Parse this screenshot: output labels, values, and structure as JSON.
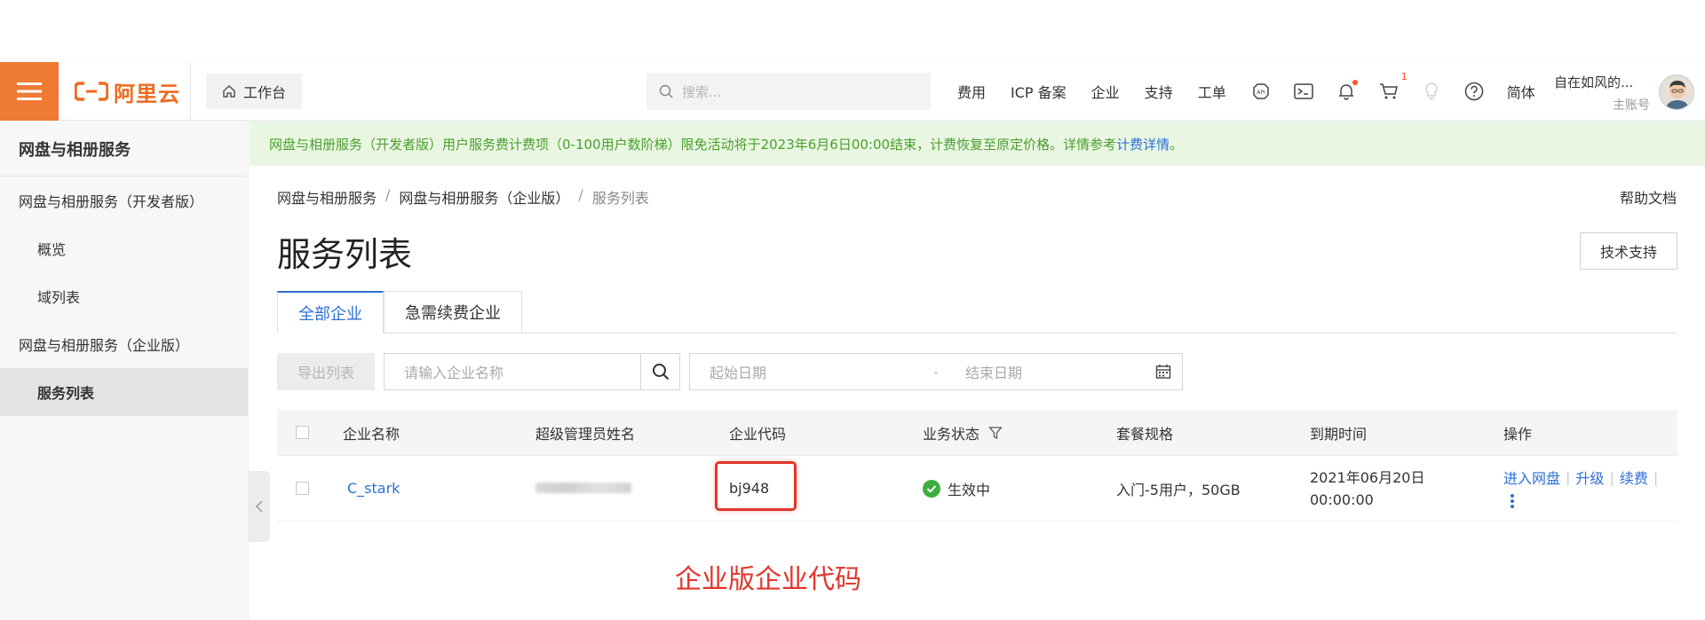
{
  "header": {
    "logo_text": "阿里云",
    "workbench_label": "工作台",
    "search_placeholder": "搜索...",
    "nav": [
      "费用",
      "ICP 备案",
      "企业",
      "支持",
      "工单"
    ],
    "cart_count": "1",
    "language": "简体",
    "user_name": "自在如风的...",
    "user_role": "主账号",
    "accent_color": "#ef7a33"
  },
  "sidebar": {
    "title": "网盘与相册服务",
    "items": [
      {
        "label": "网盘与相册服务（开发者版）"
      },
      {
        "label": "概览"
      },
      {
        "label": "域列表"
      },
      {
        "label": "网盘与相册服务（企业版）"
      },
      {
        "label": "服务列表"
      }
    ]
  },
  "notice": {
    "text": "网盘与相册服务（开发者版）用户服务费计费项（0-100用户数阶梯）限免活动将于2023年6月6日00:00结束，计费恢复至原定价格。详情参考",
    "link": "计费详情",
    "suffix": "。"
  },
  "breadcrumb": {
    "items": [
      "网盘与相册服务",
      "网盘与相册服务（企业版）",
      "服务列表"
    ],
    "separator": "/"
  },
  "help_link": "帮助文档",
  "page_title": "服务列表",
  "tech_support_label": "技术支持",
  "tabs": [
    {
      "label": "全部企业"
    },
    {
      "label": "急需续费企业"
    }
  ],
  "toolbar": {
    "export_label": "导出列表",
    "enterprise_placeholder": "请输入企业名称",
    "start_date_placeholder": "起始日期",
    "date_separator": "-",
    "end_date_placeholder": "结束日期"
  },
  "table": {
    "headers": [
      "企业名称",
      "超级管理员姓名",
      "企业代码",
      "业务状态",
      "套餐规格",
      "到期时间",
      "操作"
    ],
    "rows": [
      {
        "name": "C_stark",
        "code": "bj948",
        "status": "生效中",
        "plan": "入门-5用户，50GB",
        "expire_date": "2021年06月20日",
        "expire_time": "00:00:00",
        "actions": [
          "进入网盘",
          "升级",
          "续费"
        ]
      }
    ]
  },
  "annotation": "企业版企业代码"
}
